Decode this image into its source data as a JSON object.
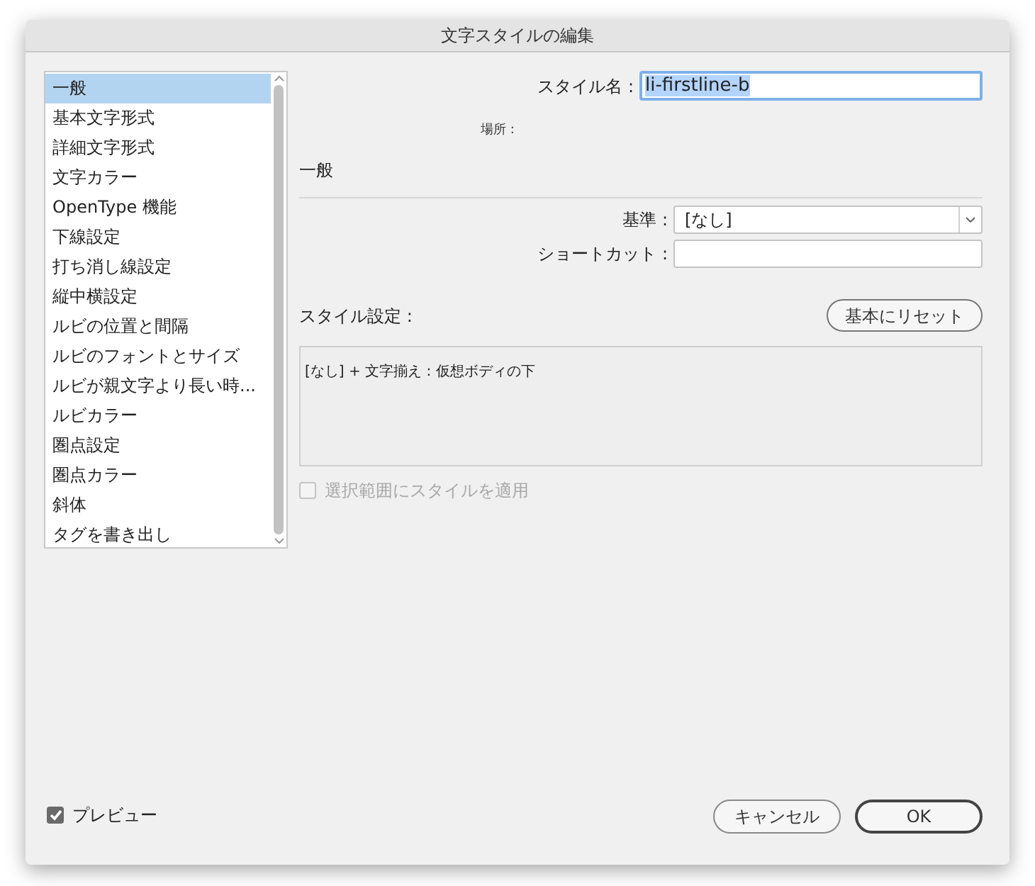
{
  "window": {
    "title": "文字スタイルの編集"
  },
  "categories": [
    {
      "label": "一般",
      "selected": true
    },
    {
      "label": "基本文字形式",
      "selected": false
    },
    {
      "label": "詳細文字形式",
      "selected": false
    },
    {
      "label": "文字カラー",
      "selected": false
    },
    {
      "label": "OpenType 機能",
      "selected": false
    },
    {
      "label": "下線設定",
      "selected": false
    },
    {
      "label": "打ち消し線設定",
      "selected": false
    },
    {
      "label": "縦中横設定",
      "selected": false
    },
    {
      "label": "ルビの位置と間隔",
      "selected": false
    },
    {
      "label": "ルビのフォントとサイズ",
      "selected": false
    },
    {
      "label": "ルビが親文字より長い時...",
      "selected": false
    },
    {
      "label": "ルビカラー",
      "selected": false
    },
    {
      "label": "圏点設定",
      "selected": false
    },
    {
      "label": "圏点カラー",
      "selected": false
    },
    {
      "label": "斜体",
      "selected": false
    },
    {
      "label": "タグを書き出し",
      "selected": false
    }
  ],
  "style_name": {
    "label": "スタイル名 :",
    "value": "li-firstline-b"
  },
  "location": {
    "label": "場所 :"
  },
  "section_title": "一般",
  "based_on": {
    "label": "基準 :",
    "value": "[なし]"
  },
  "shortcut": {
    "label": "ショートカット :"
  },
  "style_settings": {
    "label": "スタイル設定 :",
    "reset_button": "基本にリセット",
    "text": "[なし] + 文字揃え : 仮想ボディの下"
  },
  "apply_to_selection": {
    "label": "選択範囲にスタイルを適用",
    "checked": false,
    "disabled": true
  },
  "preview": {
    "label": "プレビュー",
    "checked": true
  },
  "buttons": [
    {
      "label": "キャンセル",
      "kind": "normal"
    },
    {
      "label": "OK",
      "kind": "default"
    }
  ]
}
